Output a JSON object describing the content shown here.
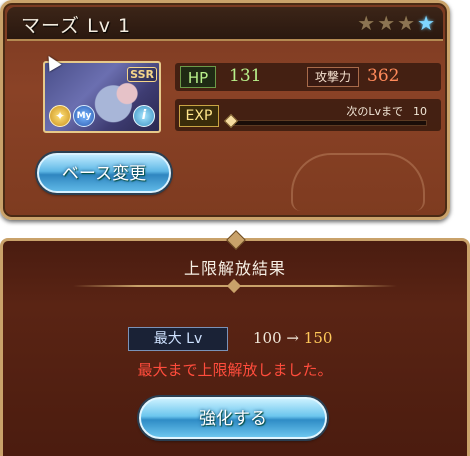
{
  "character": {
    "name": "マーズ",
    "level_text": "Lv 1",
    "rarity_badge": "SSR",
    "my_badge": "My",
    "info_badge": "i",
    "stars": [
      {
        "icon": "star-icon",
        "state": "filled"
      },
      {
        "icon": "star-icon",
        "state": "filled"
      },
      {
        "icon": "star-icon",
        "state": "filled"
      },
      {
        "icon": "star-icon",
        "state": "highlighted"
      }
    ]
  },
  "stats": {
    "hp_label": "HP",
    "hp_value": "131",
    "atk_label": "攻撃力",
    "atk_value": "362",
    "exp_label": "EXP",
    "next_level_label": "次のLvまで",
    "next_level_value": "10",
    "exp_progress": 0.0
  },
  "buttons": {
    "change_base": "ベース変更",
    "enhance": "強化する"
  },
  "result": {
    "title": "上限解放結果",
    "max_lv_label": "最大 Lv",
    "old_max": "100",
    "arrow": "→",
    "new_max": "150",
    "message": "最大まで上限解放しました。"
  },
  "colors": {
    "panel_brown": "#8a4226",
    "result_brown": "#5a2414",
    "gold_trim": "#c9a26a",
    "hp_green": "#b8f08a",
    "atk_orange": "#ff8a5a",
    "message_red": "#ff4c3c",
    "new_max_gold": "#ffc85a",
    "button_blue": "#5fb8e6"
  }
}
